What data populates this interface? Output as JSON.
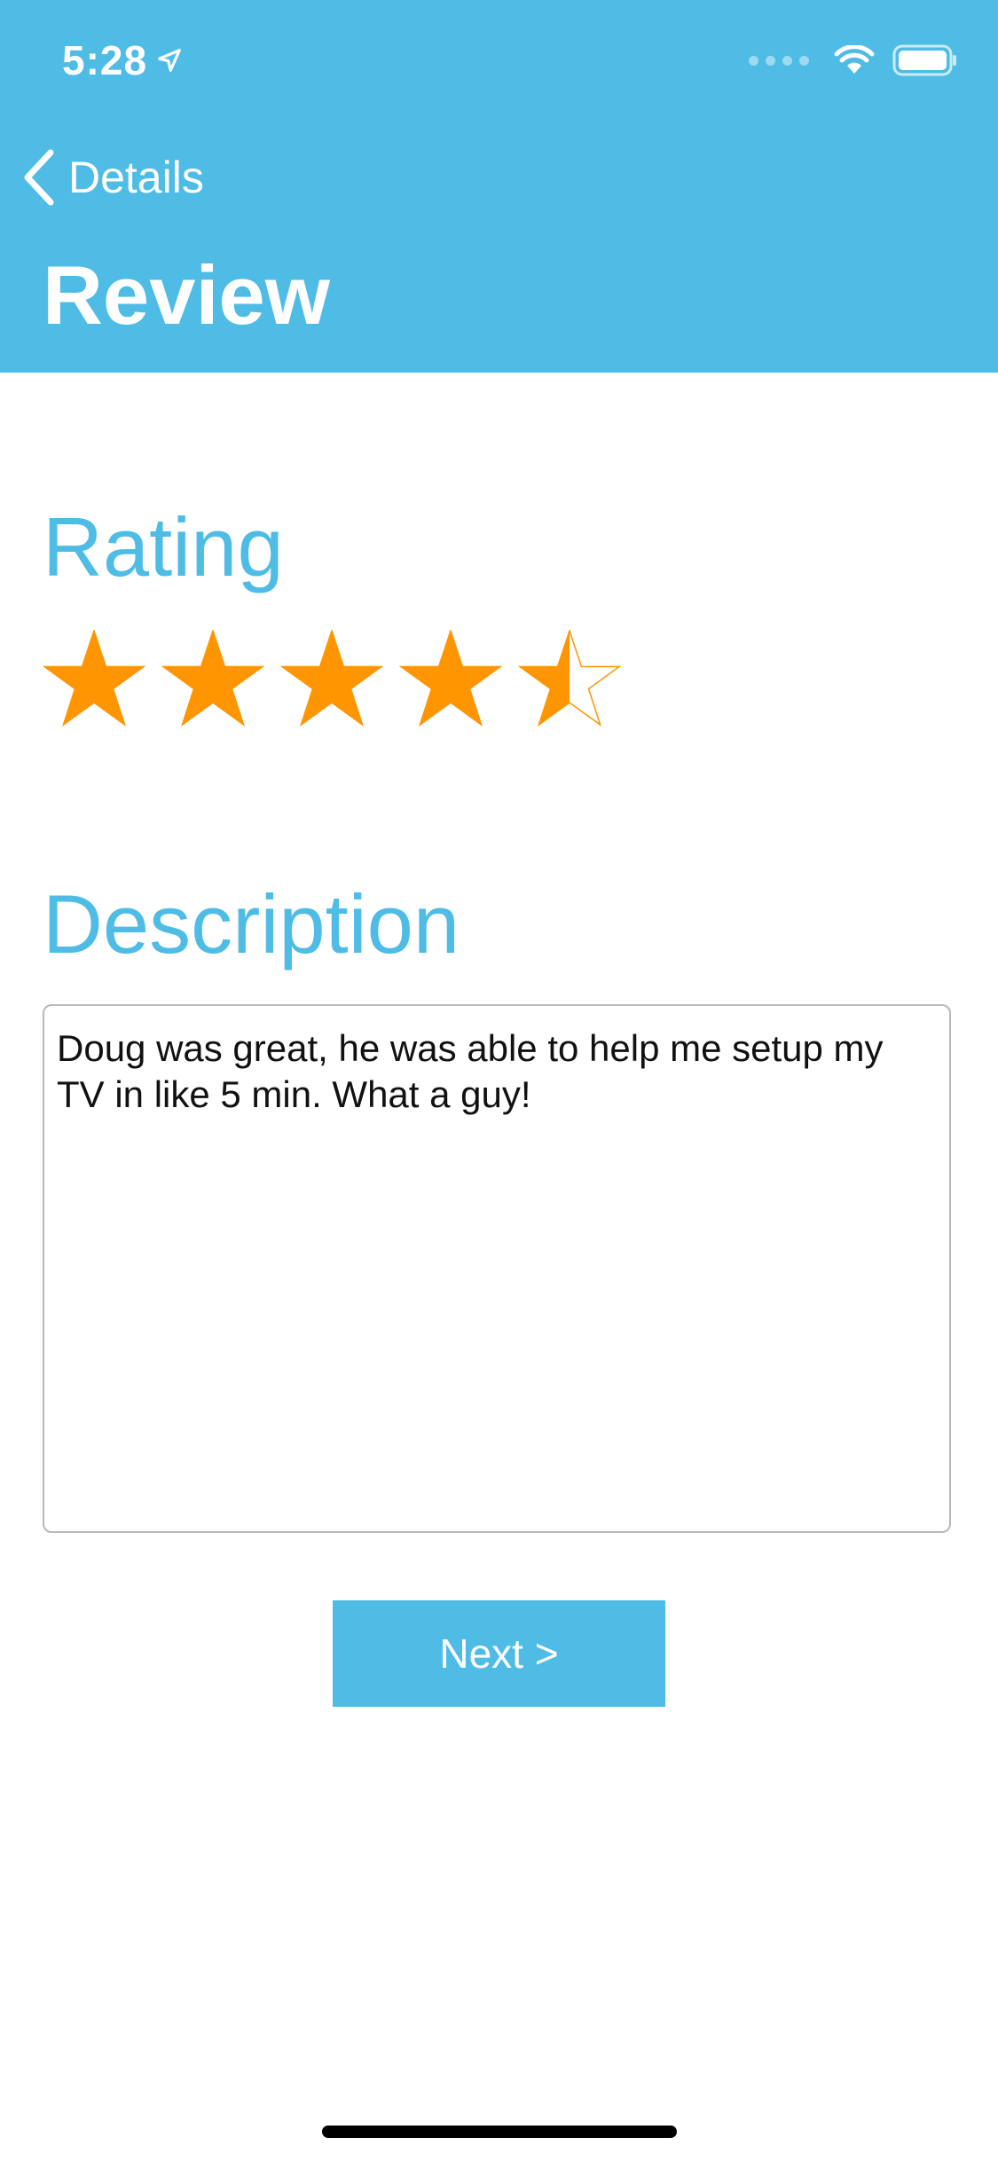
{
  "status_bar": {
    "time": "5:28",
    "location_icon": "location-arrow-icon",
    "wifi_icon": "wifi-icon",
    "battery_icon": "battery-icon"
  },
  "nav": {
    "back_label": "Details",
    "back_icon": "chevron-left-icon",
    "title": "Review"
  },
  "rating": {
    "title": "Rating",
    "value": 4.5,
    "max": 5,
    "star_color": "#FF9500"
  },
  "description": {
    "title": "Description",
    "text": "Doug was great, he was able to help me setup my TV in like 5 min. What a guy!"
  },
  "next_button": {
    "label": "Next >"
  },
  "colors": {
    "accent": "#4EBCE5",
    "star": "#FF9500"
  }
}
